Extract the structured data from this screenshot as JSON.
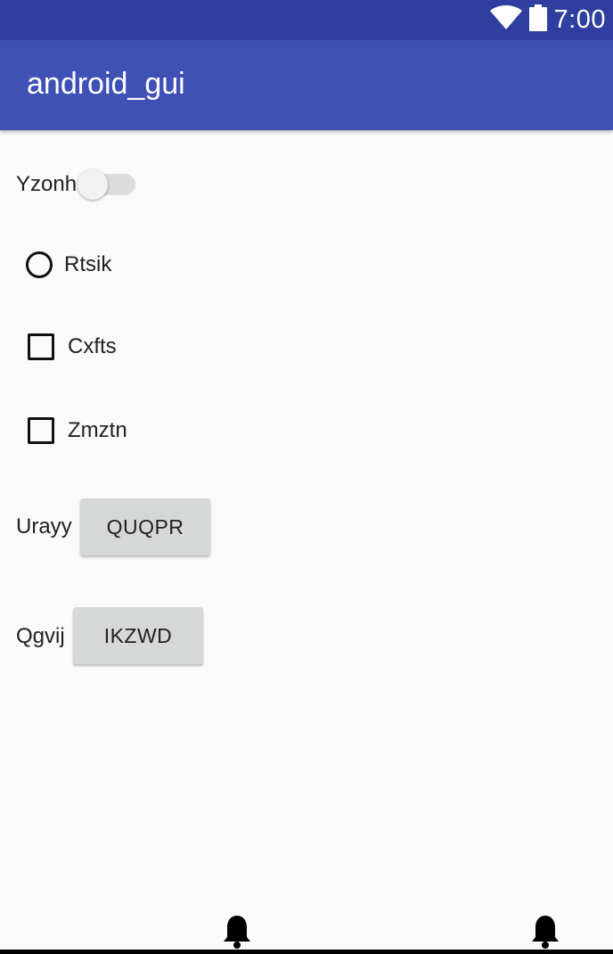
{
  "status_bar": {
    "time": "7:00",
    "icons": [
      "wifi-icon",
      "battery-icon"
    ]
  },
  "app_bar": {
    "title": "android_gui"
  },
  "switch": {
    "label": "Yzonh",
    "checked": false
  },
  "radio": {
    "label": "Rtsik",
    "checked": false
  },
  "checkboxes": [
    {
      "label": "Cxfts",
      "checked": false
    },
    {
      "label": "Zmztn",
      "checked": false
    }
  ],
  "button_rows": [
    {
      "label": "Urayy",
      "button": "QUQPR"
    },
    {
      "label": "Qgvij",
      "button": "IKZWD"
    }
  ],
  "bottom_icons": [
    "bell-icon",
    "bell-icon"
  ],
  "colors": {
    "status_bar": "#303f9f",
    "app_bar": "#3f51b5",
    "background": "#fafafa",
    "button": "#d6d7d7"
  }
}
